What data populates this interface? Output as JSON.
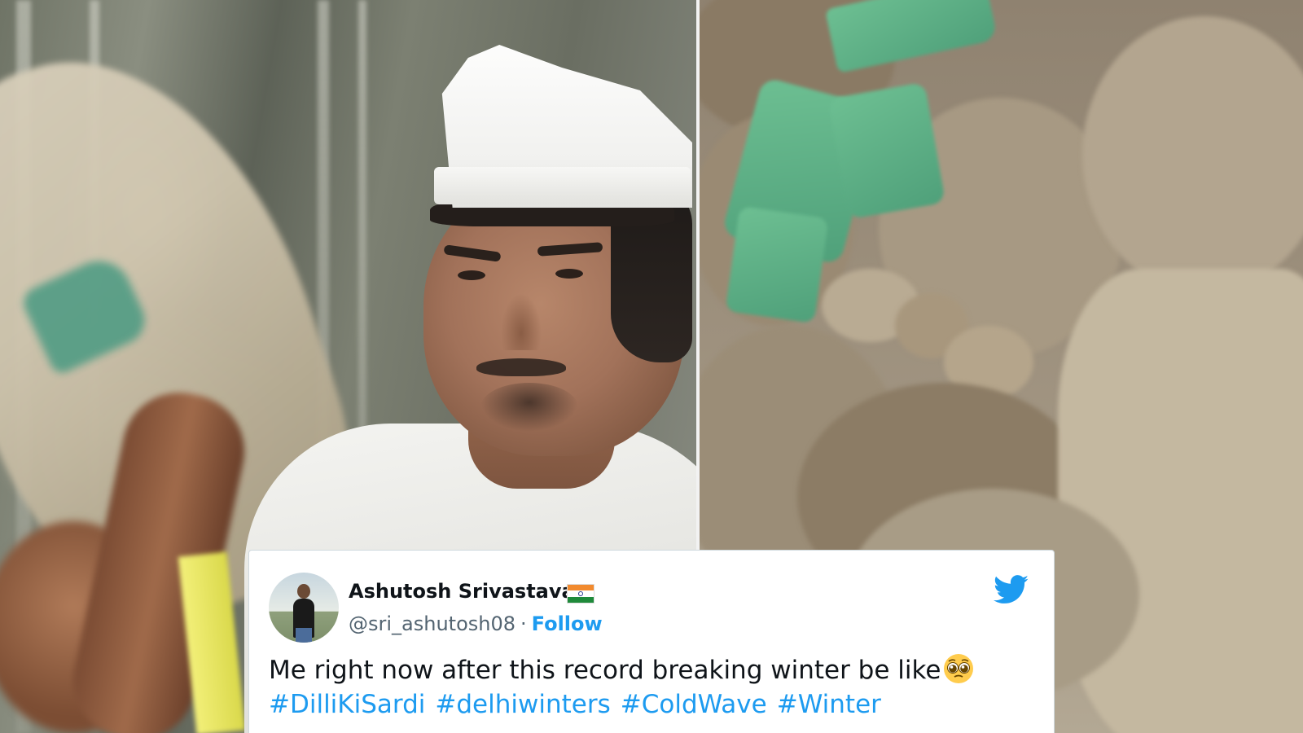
{
  "tweet": {
    "display_name": "Ashutosh Srivastava",
    "flag": "India flag emoji",
    "handle": "@sri_ashutosh08",
    "separator": "·",
    "follow_label": "Follow",
    "text": "Me right now after this record breaking winter be like",
    "emoji": "pleading face emoji",
    "hashtags": [
      "#DilliKiSardi",
      "#delhiwinters",
      "#ColdWave",
      "#Winter"
    ],
    "brand_icon": "twitter-bird-icon",
    "colors": {
      "link": "#1d9bf0",
      "name": "#0f1419",
      "handle": "#536471"
    }
  },
  "photos": {
    "left": "man in white cap and white shirt carrying a jute sack",
    "right": "pile of jute sacks with green patch"
  }
}
